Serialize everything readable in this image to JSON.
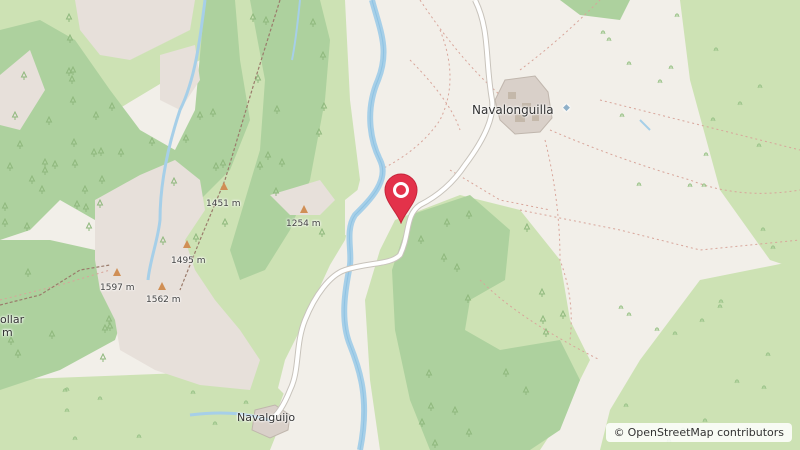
{
  "map": {
    "places": {
      "navalonguilla": "Navalonguilla",
      "navalguijo": "Navalguijo",
      "collar_partial": "ollar",
      "collar_unit": "m"
    },
    "peaks": {
      "p1451": "1451 m",
      "p1254": "1254 m",
      "p1495": "1495 m",
      "p1597": "1597 m",
      "p1562": "1562 m"
    },
    "attribution": {
      "symbol": "©",
      "text": "OpenStreetMap contributors"
    },
    "marker": {
      "icon": "location-pin-icon",
      "color": "#e3324a"
    },
    "colors": {
      "background": "#f2efe9",
      "forest": "#add19e",
      "meadow": "#cde2b4",
      "rock": "#e7e0da",
      "water": "#a6cfe8",
      "road": "#ffffff",
      "road_casing": "#c8c3bb"
    }
  }
}
